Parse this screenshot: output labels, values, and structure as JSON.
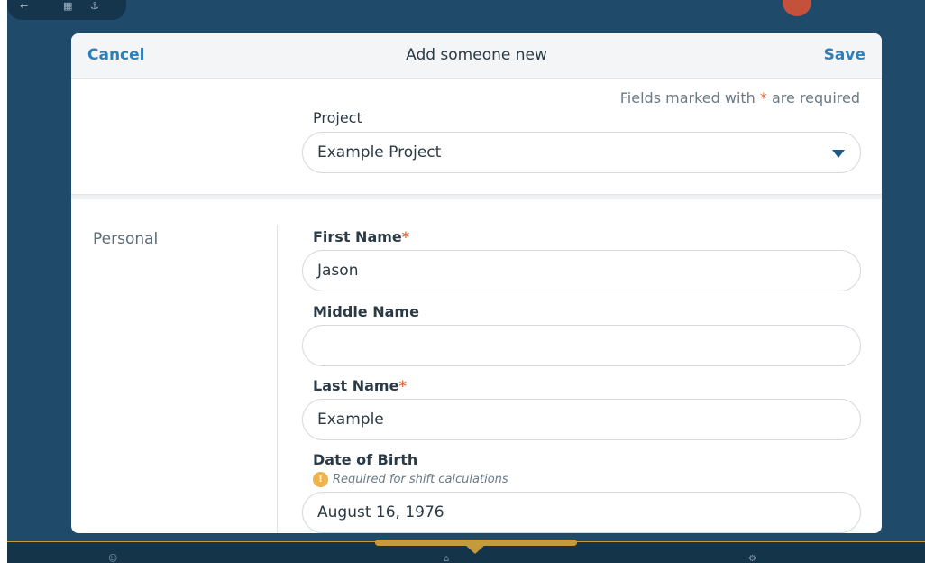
{
  "header": {
    "cancel_label": "Cancel",
    "title": "Add someone new",
    "save_label": "Save"
  },
  "form": {
    "required_note_prefix": "Fields marked with ",
    "required_marker": "*",
    "required_note_suffix": " are required",
    "project": {
      "label": "Project",
      "value": "Example Project"
    },
    "section_personal": "Personal",
    "first_name": {
      "label": "First Name",
      "value": "Jason"
    },
    "middle_name": {
      "label": "Middle Name",
      "value": ""
    },
    "last_name": {
      "label": "Last Name",
      "value": "Example"
    },
    "date_of_birth": {
      "label": "Date of Birth",
      "hint": "Required for shift calculations",
      "value": "August 16, 1976"
    }
  },
  "colors": {
    "background": "#1f4a69",
    "accent": "#2f7fb8",
    "required_star": "#e06a44",
    "warning": "#f0b24a",
    "handle": "#c39b3d"
  },
  "icons": {
    "dropdown": "chevron-down-icon",
    "warning": "warning-icon"
  }
}
